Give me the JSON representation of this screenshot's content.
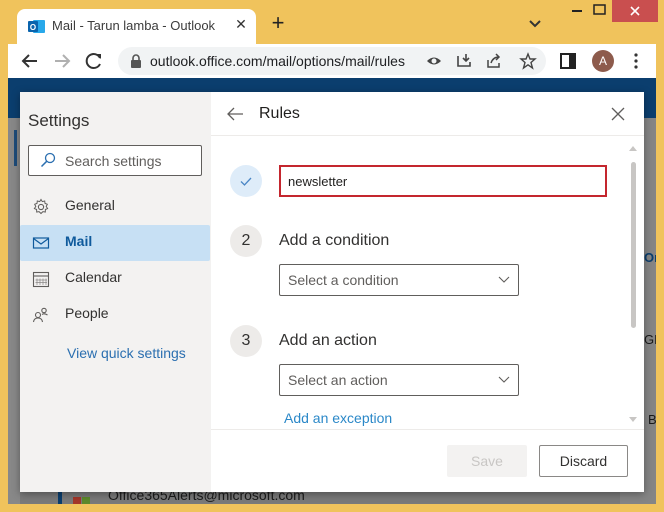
{
  "browser": {
    "tab_title": "Mail - Tarun lamba - Outlook",
    "url": "outlook.office.com/mail/options/mail/rules",
    "profile_initial": "A",
    "accent_color": "#f0c35c"
  },
  "background": {
    "email_sender": "Office365Alerts@microsoft.com",
    "right_fragments": [
      "On",
      "GF",
      "B"
    ]
  },
  "settings": {
    "title": "Settings",
    "search_placeholder": "Search settings",
    "nav": [
      {
        "label": "General",
        "icon": "gear-icon",
        "active": false
      },
      {
        "label": "Mail",
        "icon": "mail-icon",
        "active": true
      },
      {
        "label": "Calendar",
        "icon": "calendar-icon",
        "active": false
      },
      {
        "label": "People",
        "icon": "people-icon",
        "active": false
      }
    ],
    "quick_settings_link": "View quick settings"
  },
  "rules": {
    "title": "Rules",
    "rule_name_value": "newsletter",
    "steps": [
      {
        "number": "1",
        "status": "done"
      },
      {
        "number": "2",
        "label": "Add a condition",
        "dropdown_placeholder": "Select a condition"
      },
      {
        "number": "3",
        "label": "Add an action",
        "dropdown_placeholder": "Select an action"
      }
    ],
    "exception_link": "Add an exception",
    "save_label": "Save",
    "discard_label": "Discard",
    "highlight_color": "#c4262e"
  }
}
